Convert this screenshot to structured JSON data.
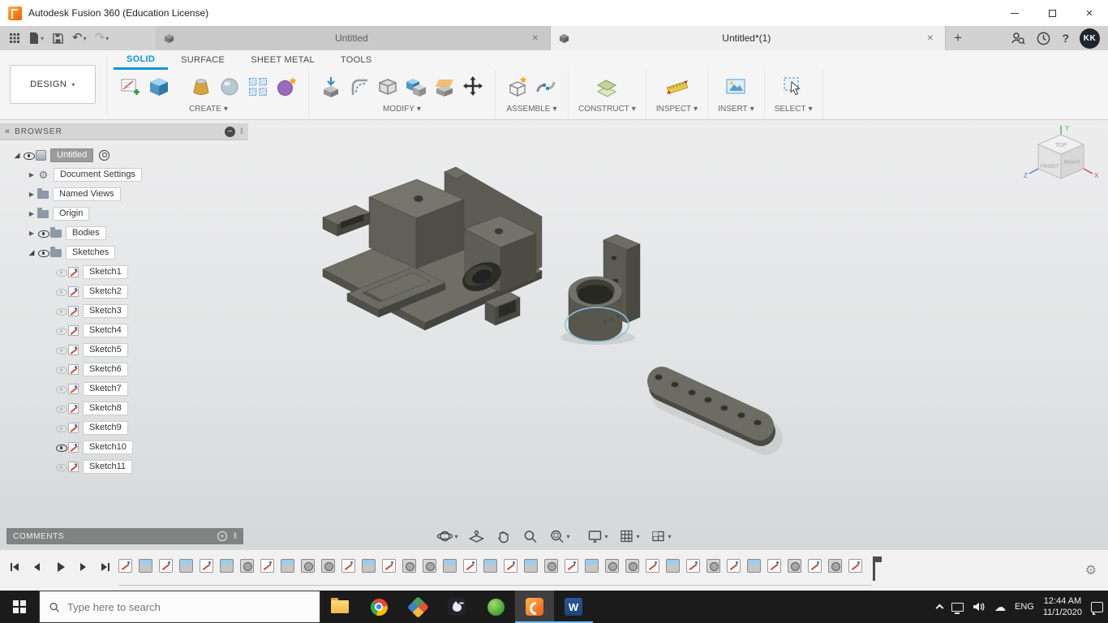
{
  "window": {
    "title": "Autodesk Fusion 360 (Education License)"
  },
  "account": {
    "initials": "KK"
  },
  "icons": {
    "caret_down": "▾",
    "close": "✕",
    "plus": "+",
    "minus": "−",
    "help": "?",
    "undo": "↶",
    "redo": "↷",
    "chevrons_left": "«",
    "grip": "‖",
    "gear": "⚙",
    "cloud": "☁"
  },
  "doc_tabs": {
    "tabs": [
      {
        "label": "Untitled",
        "active": false
      },
      {
        "label": "Untitled*(1)",
        "active": true
      }
    ]
  },
  "ribbon": {
    "workspace": "DESIGN",
    "tabs": [
      "SOLID",
      "SURFACE",
      "SHEET METAL",
      "TOOLS"
    ],
    "active_tab": "SOLID",
    "groups": [
      "CREATE",
      "MODIFY",
      "ASSEMBLE",
      "CONSTRUCT",
      "INSPECT",
      "INSERT",
      "SELECT"
    ]
  },
  "browser": {
    "header": "BROWSER",
    "root_label": "Untitled",
    "nodes": [
      "Document Settings",
      "Named Views",
      "Origin",
      "Bodies",
      "Sketches"
    ],
    "sketches": [
      {
        "label": "Sketch1",
        "visible": false
      },
      {
        "label": "Sketch2",
        "visible": false
      },
      {
        "label": "Sketch3",
        "visible": false
      },
      {
        "label": "Sketch4",
        "visible": false
      },
      {
        "label": "Sketch5",
        "visible": false
      },
      {
        "label": "Sketch6",
        "visible": false
      },
      {
        "label": "Sketch7",
        "visible": false
      },
      {
        "label": "Sketch8",
        "visible": false
      },
      {
        "label": "Sketch9",
        "visible": false
      },
      {
        "label": "Sketch10",
        "visible": true
      },
      {
        "label": "Sketch11",
        "visible": false
      }
    ]
  },
  "viewcube": {
    "top": "TOP",
    "front": "FRONT",
    "right": "RIGHT",
    "axis_x": "X",
    "axis_y": "Y",
    "axis_z": "Z"
  },
  "comments": {
    "label": "COMMENTS"
  },
  "timeline": {
    "items": [
      "sketch",
      "extrude",
      "sketch",
      "extrude",
      "sketch",
      "extrude",
      "hole",
      "sketch",
      "extrude",
      "hole",
      "hole",
      "sketch",
      "extrude",
      "sketch",
      "hole",
      "hole",
      "extrude",
      "sketch",
      "extrude",
      "sketch",
      "extrude",
      "hole",
      "sketch",
      "extrude",
      "hole",
      "hole",
      "sketch",
      "extrude",
      "sketch",
      "hole",
      "sketch",
      "extrude",
      "sketch",
      "hole",
      "sketch",
      "hole",
      "sketch"
    ]
  },
  "taskbar": {
    "search_placeholder": "Type here to search",
    "tray": {
      "language": "ENG",
      "time": "12:44 AM",
      "date": "11/1/2020"
    }
  }
}
